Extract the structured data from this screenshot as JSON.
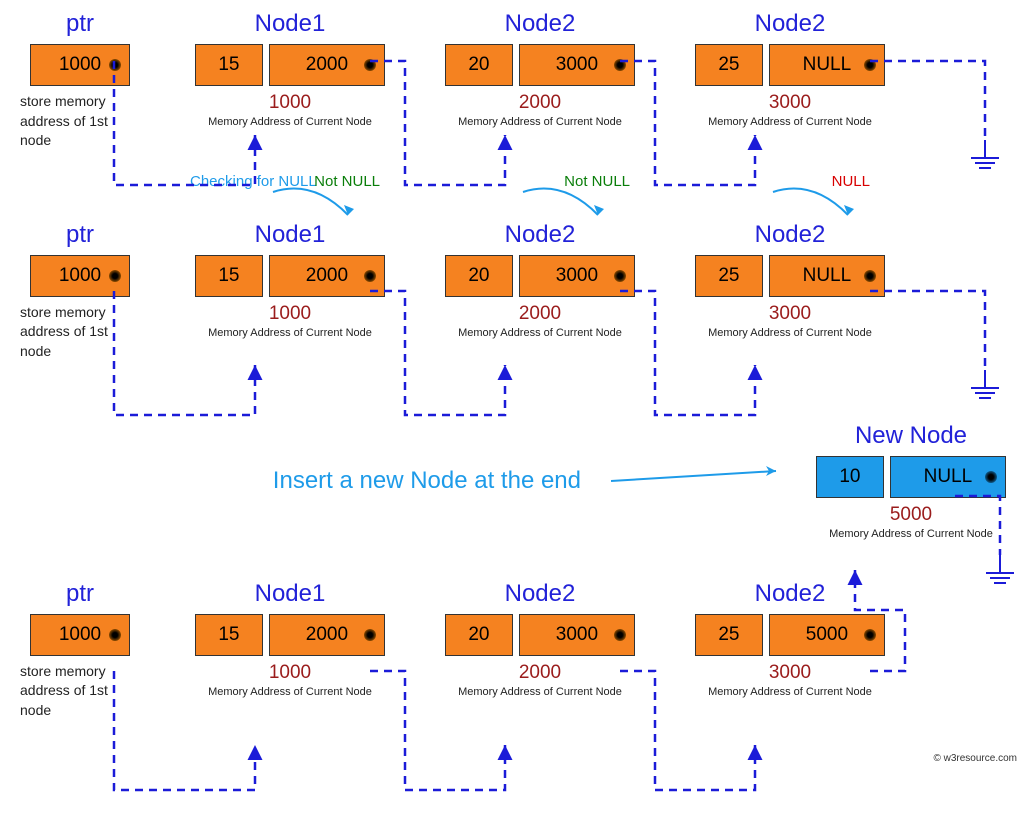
{
  "labels": {
    "ptr": "ptr",
    "ptr_caption": "store memory\naddress of 1st\nnode",
    "addr_caption": "Memory Address of Current Node",
    "checking": "Checking for NULL",
    "not_null": "Not NULL",
    "null": "NULL",
    "insert": "Insert a new Node at the end",
    "new_node": "New Node",
    "watermark": "© w3resource.com"
  },
  "row1": {
    "ptr": "1000",
    "nodes": [
      {
        "title": "Node1",
        "data": "15",
        "next": "2000",
        "addr": "1000"
      },
      {
        "title": "Node2",
        "data": "20",
        "next": "3000",
        "addr": "2000"
      },
      {
        "title": "Node2",
        "data": "25",
        "next": "NULL",
        "addr": "3000"
      }
    ]
  },
  "row2": {
    "ptr": "1000",
    "annot": [
      {
        "check": true,
        "status": "Not NULL"
      },
      {
        "check": false,
        "status": "Not NULL"
      },
      {
        "check": false,
        "status": "NULL"
      }
    ],
    "nodes": [
      {
        "title": "Node1",
        "data": "15",
        "next": "2000",
        "addr": "1000"
      },
      {
        "title": "Node2",
        "data": "20",
        "next": "3000",
        "addr": "2000"
      },
      {
        "title": "Node2",
        "data": "25",
        "next": "NULL",
        "addr": "3000"
      }
    ]
  },
  "new_node": {
    "data": "10",
    "next": "NULL",
    "addr": "5000"
  },
  "row3": {
    "ptr": "1000",
    "nodes": [
      {
        "title": "Node1",
        "data": "15",
        "next": "2000",
        "addr": "1000"
      },
      {
        "title": "Node2",
        "data": "20",
        "next": "3000",
        "addr": "2000"
      },
      {
        "title": "Node2",
        "data": "25",
        "next": "5000",
        "addr": "3000"
      }
    ]
  }
}
